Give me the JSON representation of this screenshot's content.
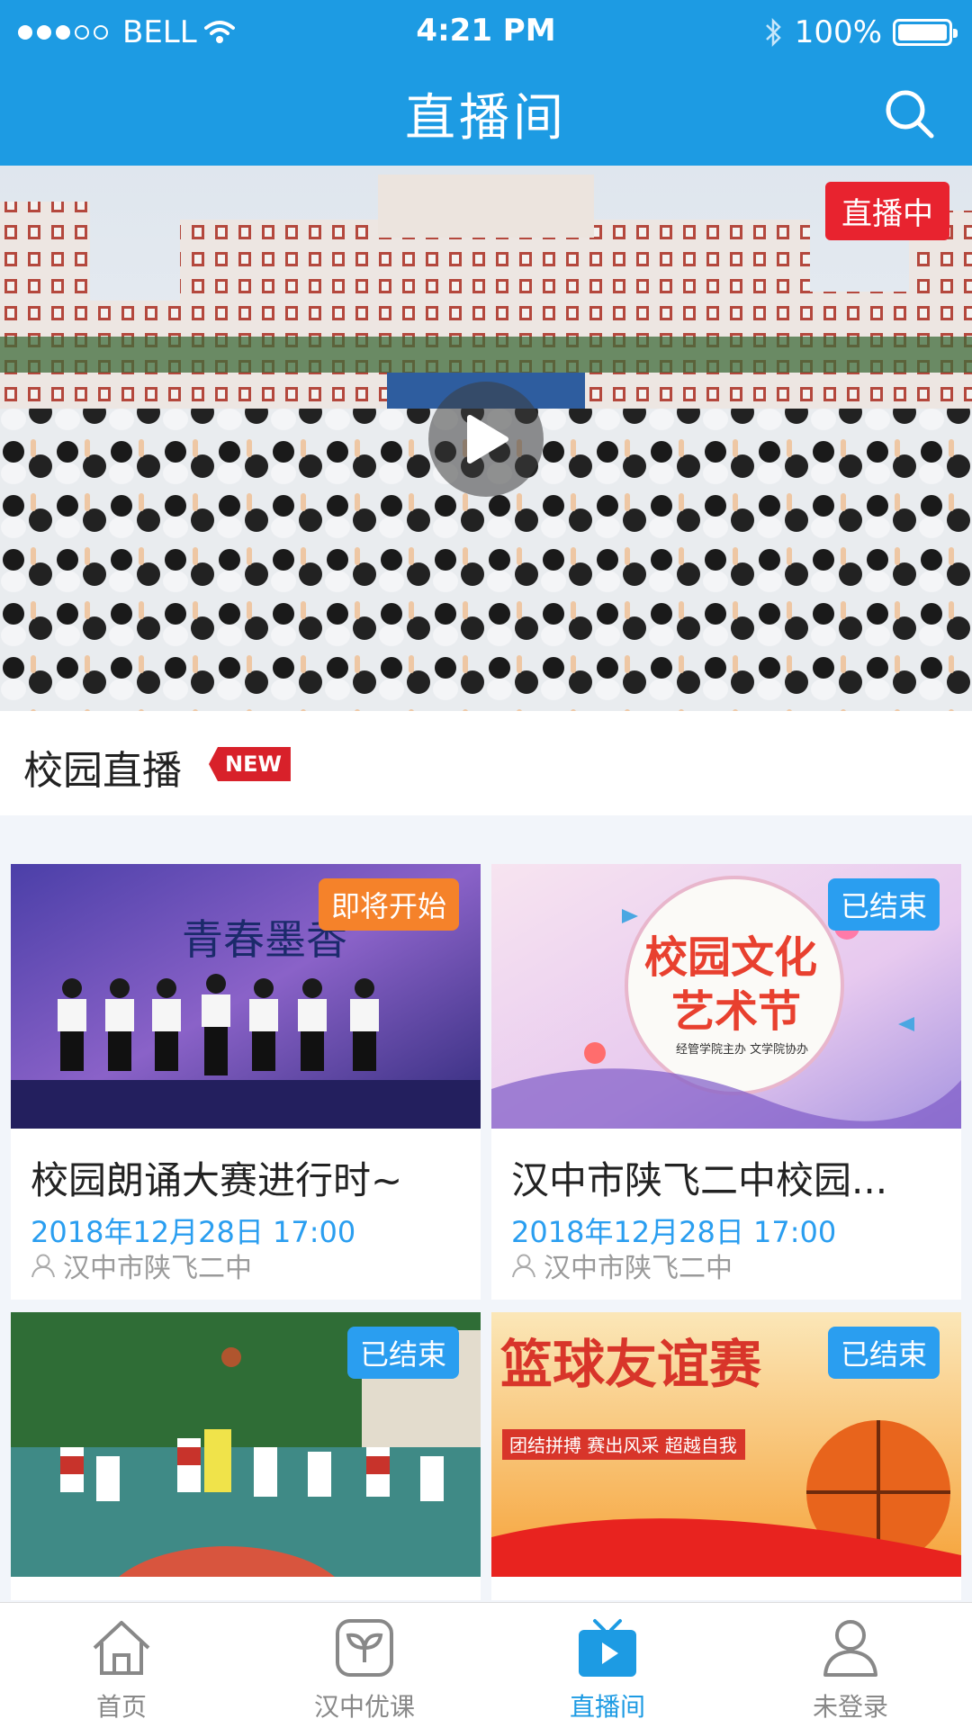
{
  "status_bar": {
    "carrier": "BELL",
    "time": "4:21 PM",
    "battery": "100%"
  },
  "header": {
    "title": "直播间",
    "search_icon": "search-icon"
  },
  "hero": {
    "badge": "直播中",
    "play_icon": "play-icon"
  },
  "section": {
    "title": "校园直播",
    "badge": "NEW"
  },
  "cards": [
    {
      "status": "即将开始",
      "status_color": "#f5822a",
      "title": "校园朗诵大赛进行时~",
      "date": "2018年12月28日 17:00",
      "org": "汉中市陕飞二中"
    },
    {
      "status": "已结束",
      "status_color": "#2a9ef0",
      "title": "汉中市陕飞二中校园...",
      "date": "2018年12月28日 17:00",
      "org": "汉中市陕飞二中"
    },
    {
      "status": "已结束",
      "status_color": "#2a9ef0"
    },
    {
      "status": "已结束",
      "status_color": "#2a9ef0"
    }
  ],
  "thumb_text": {
    "reading_banner": "青春墨香",
    "festival_line1": "校园文化",
    "festival_line2": "艺术节",
    "festival_sub": "经管学院主办 文学院协办",
    "basketball_title": "篮球友谊赛",
    "basketball_sub": "团结拼搏 赛出风采 超越自我"
  },
  "tabbar": {
    "items": [
      {
        "label": "首页",
        "icon": "home-icon"
      },
      {
        "label": "汉中优课",
        "icon": "sprout-icon"
      },
      {
        "label": "直播间",
        "icon": "tv-icon",
        "active": true
      },
      {
        "label": "未登录",
        "icon": "user-icon"
      }
    ]
  }
}
